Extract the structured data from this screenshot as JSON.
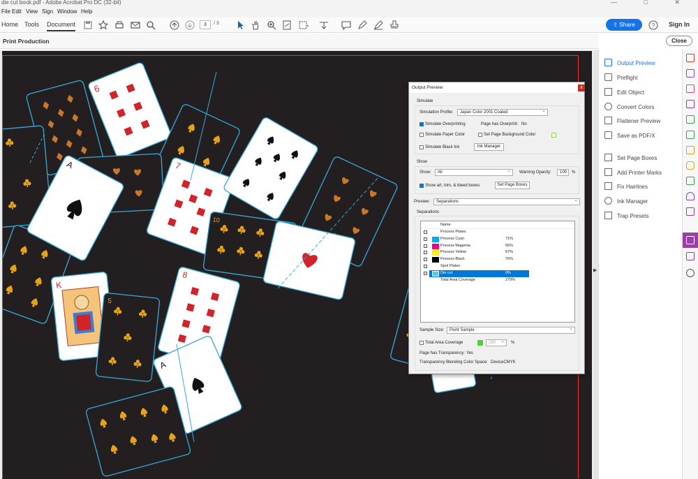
{
  "window": {
    "title": "die cut book.pdf - Adobe Acrobat Pro DC (32-bit)",
    "controls": [
      "—",
      "□",
      "✕"
    ]
  },
  "menu": [
    "File",
    "Edit",
    "View",
    "Sign",
    "Window",
    "Help"
  ],
  "tabs": {
    "home": "Home",
    "tools": "Tools",
    "document": "Document"
  },
  "toolbar": {
    "page_current": "3",
    "page_total": "/ 3",
    "share": "Share",
    "sign_in": "Sign In"
  },
  "print_production": {
    "title": "Print Production",
    "close": "Close"
  },
  "right_panel": {
    "items": [
      "Output Preview",
      "Preflight",
      "Edit Object",
      "Convert Colors",
      "Flattener Preview",
      "Save as PDF/X",
      "Set Page Boxes",
      "Add Printer Marks",
      "Fix Hairlines",
      "Ink Manager",
      "Trap Presets"
    ],
    "active": "Output Preview"
  },
  "dialog": {
    "title": "Output Preview",
    "close": "x",
    "simulate": {
      "heading": "Simulate",
      "profile_label": "Simulation Profile:",
      "profile_value": "Japan Color 2001 Coated",
      "overprinting": "Simulate Overprinting",
      "has_overprint_label": "Page has Overprint:",
      "has_overprint_value": "No",
      "paper_color": "Simulate Paper Color",
      "bg_color": "Set Page Background Color",
      "black_ink": "Simulate Black Ink",
      "ink_manager": "Ink Manager"
    },
    "show": {
      "heading": "Show",
      "show_label": "Show:",
      "show_value": "All",
      "opacity_label": "Warning Opacity:",
      "opacity_value": "100",
      "opacity_unit": "%",
      "boxes": "Show art, trim, & bleed boxes",
      "set_boxes": "Set Page Boxes"
    },
    "preview_label": "Preview:",
    "preview_value": "Separations",
    "separations": {
      "heading": "Separations",
      "col_name": "Name",
      "rows": [
        {
          "name": "Process Plates",
          "pct": "",
          "color": "",
          "check": true
        },
        {
          "name": "Process Cyan",
          "pct": "71%",
          "color": "#00aeef",
          "check": true
        },
        {
          "name": "Process Magenta",
          "pct": "65%",
          "color": "#ec008c",
          "check": true
        },
        {
          "name": "Process Yellow",
          "pct": "67%",
          "color": "#fff200",
          "check": true
        },
        {
          "name": "Process Black",
          "pct": "76%",
          "color": "#000000",
          "check": true
        },
        {
          "name": "Spot Plates",
          "pct": "",
          "color": "",
          "check": true
        },
        {
          "name": "Die cut",
          "pct": "0%",
          "color": "#5fc7e8",
          "check": true,
          "selected": true
        },
        {
          "name": "Total Area Coverage",
          "pct": "279%",
          "color": "",
          "check": false
        }
      ]
    },
    "sample_size_label": "Sample Size:",
    "sample_size_value": "Point Sample",
    "total_area_label": "Total Area Coverage",
    "total_area_value": "280",
    "total_area_unit": "%",
    "transparency_label": "Page has Transparency:",
    "transparency_value": "Yes",
    "blending_label": "Transparency Blending Color Space:",
    "blending_value": "DeviceCMYK"
  },
  "cards": {
    "nine": "9",
    "seven": "7",
    "ace": "A",
    "ace_small": "A",
    "king": "K",
    "eight": "8",
    "five": "5",
    "ten": "10",
    "six": "6"
  },
  "colors": {
    "accent": "#1473e6",
    "dieline": "#35a9d9",
    "card_dark": "#231f20",
    "orange_suit": "#e8a21a",
    "red_suit": "#d0242b",
    "rail_active": "#9b3fa8"
  }
}
